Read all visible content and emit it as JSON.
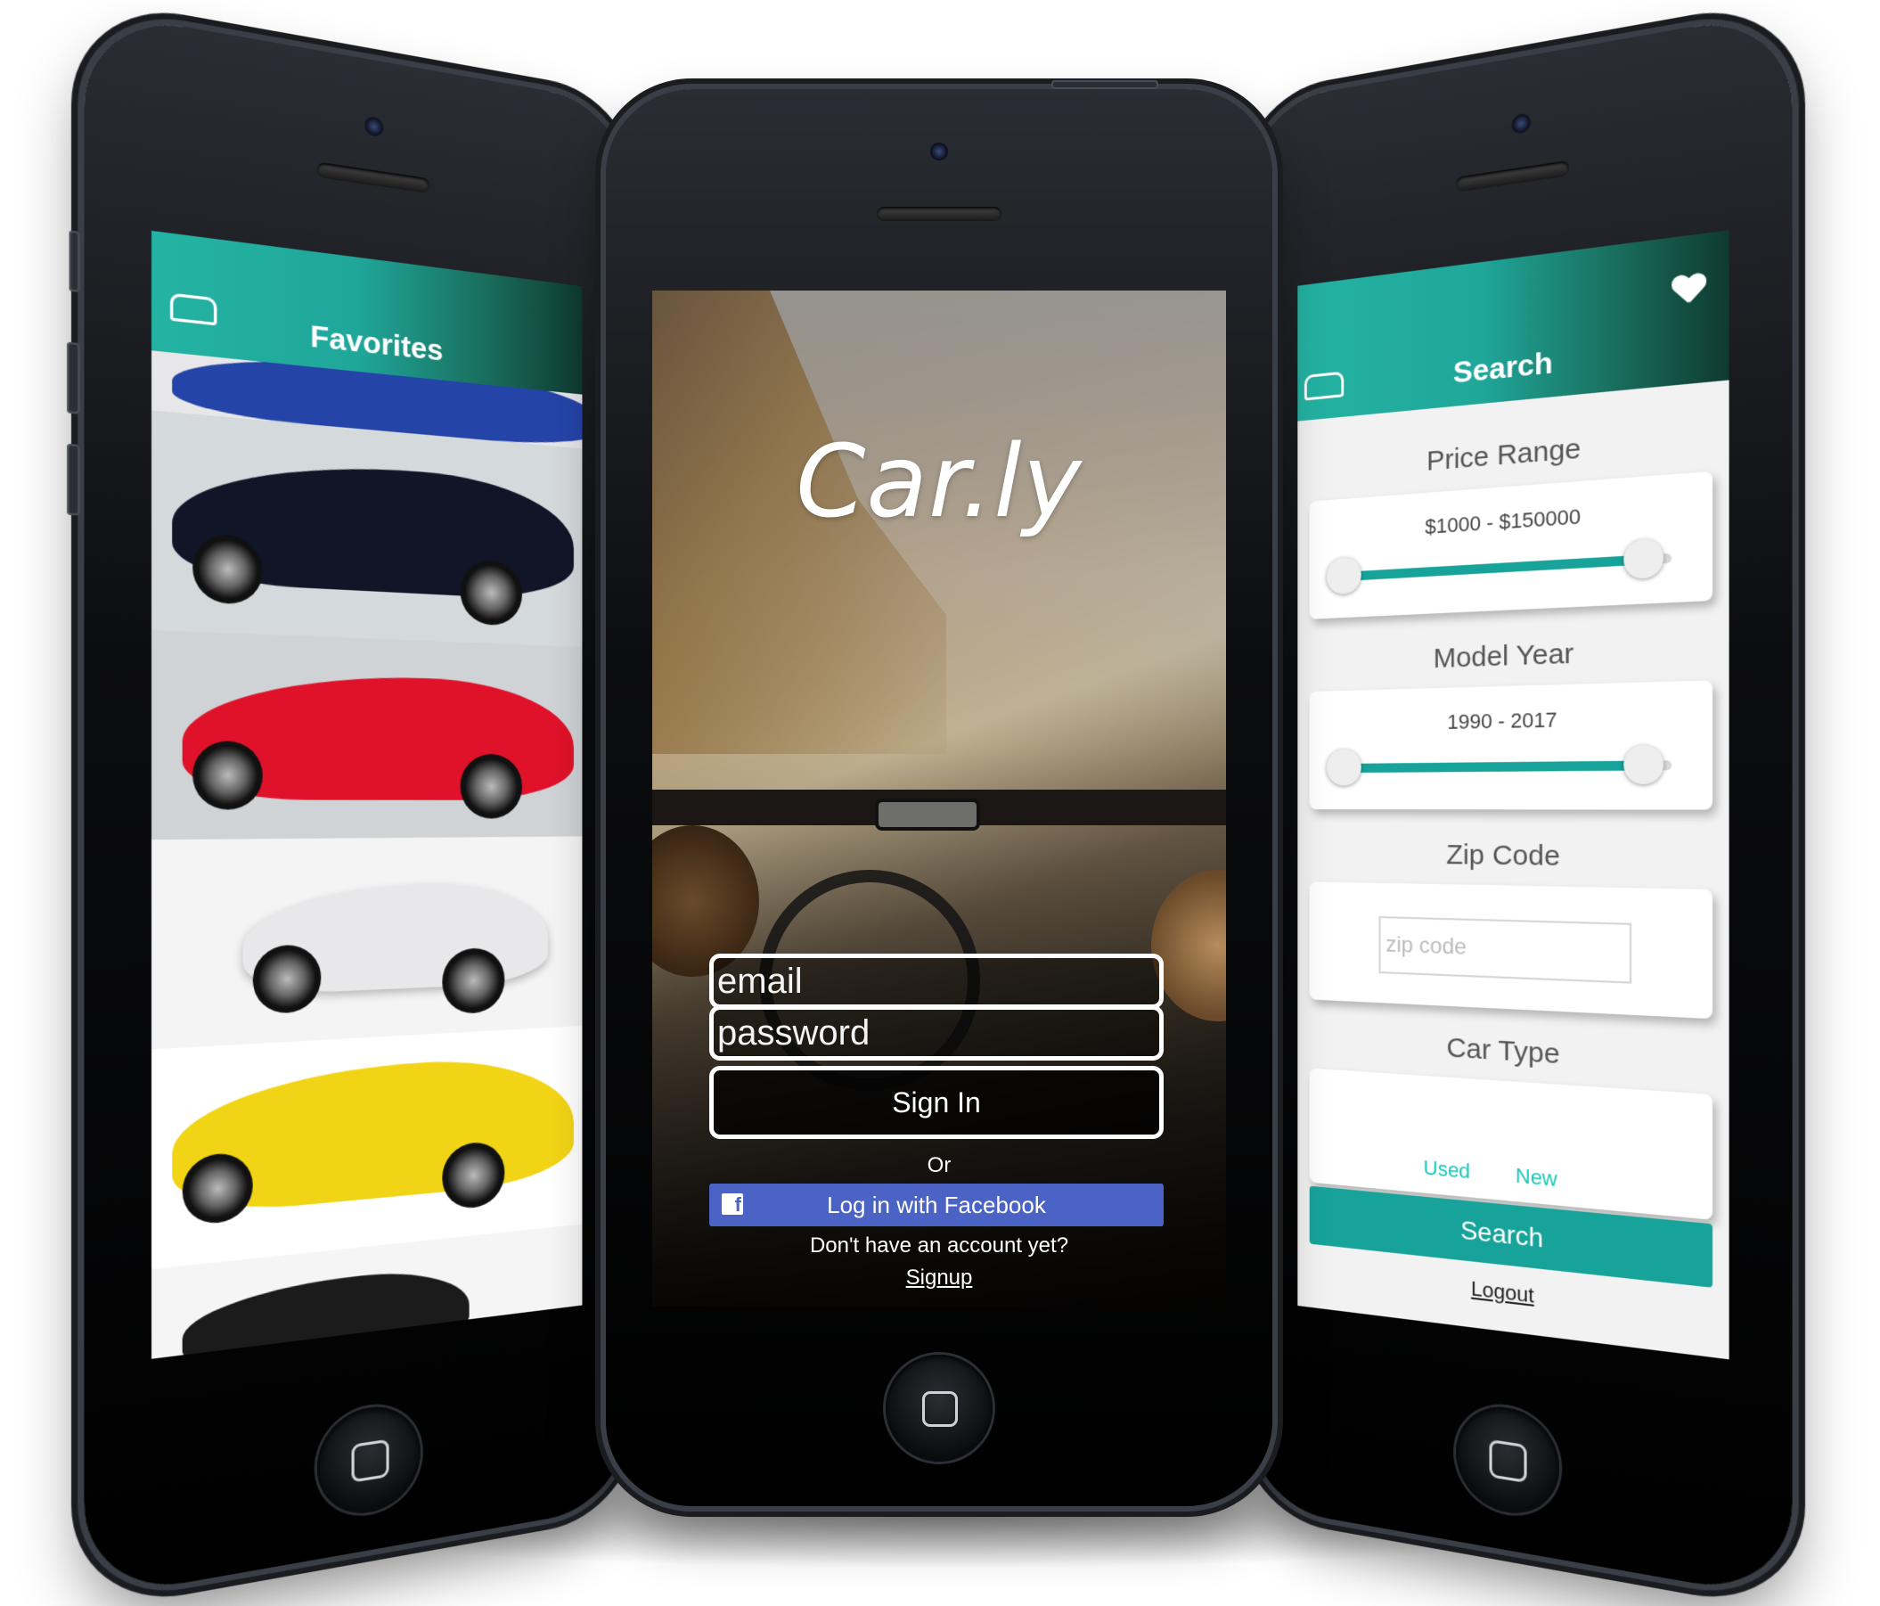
{
  "login": {
    "logo": "Car.ly",
    "email_placeholder": "email",
    "password_placeholder": "password",
    "signin_label": "Sign In",
    "or_text": "Or",
    "facebook_label": "Log in with Facebook",
    "facebook_icon": "f",
    "no_account_text": "Don't have an account yet?",
    "signup_label": "Signup"
  },
  "favorites": {
    "title": "Favorites",
    "cars": [
      {
        "color": "#2544a8",
        "bg": "#e7e7ea"
      },
      {
        "color": "#111528",
        "bg": "#d4d9dc"
      },
      {
        "color": "#e0122a",
        "bg": "#cfd3d6"
      },
      {
        "color": "#e8e8ea",
        "bg": "#f4f4f4"
      },
      {
        "color": "#f2d416",
        "bg": "#ffffff"
      },
      {
        "color": "#1b1b1b",
        "bg": "#f5f5f5"
      }
    ]
  },
  "search": {
    "title": "Search",
    "price_label": "Price Range",
    "price_value": "$1000 - $150000",
    "price_fill": 0.92,
    "year_label": "Model Year",
    "year_value": "1990 - 2017",
    "year_fill": 0.92,
    "zip_label": "Zip Code",
    "zip_placeholder": "zip code",
    "cartype_label": "Car Type",
    "cartype_used": "Used",
    "cartype_new": "New",
    "search_label": "Search",
    "logout_label": "Logout"
  },
  "colors": {
    "teal": "#17a39a",
    "facebook": "#4a63c4"
  }
}
